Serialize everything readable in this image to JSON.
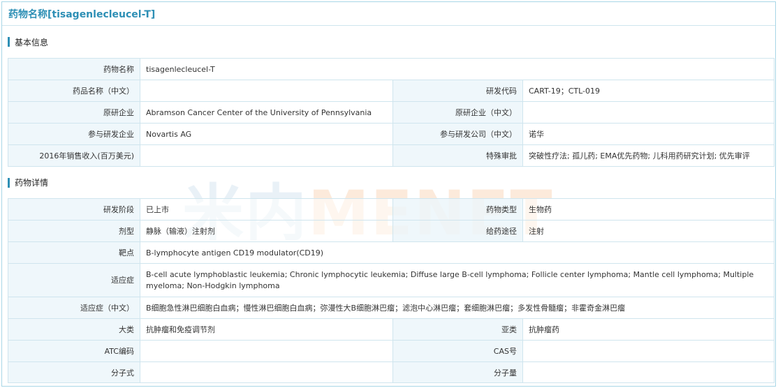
{
  "page_title": "药物名称[tisagenlecleucel-T]",
  "watermark": {
    "cn": "米内",
    "en": "MENET"
  },
  "basic_info": {
    "title": "基本信息",
    "drug_name_label": "药物名称",
    "drug_name_value": "tisagenlecleucel-T",
    "product_name_cn_label": "药品名称（中文）",
    "product_name_cn_value": "",
    "dev_code_label": "研发代码",
    "dev_code_value": "CART-19；CTL-019",
    "originator_label": "原研企业",
    "originator_value": "Abramson Cancer Center of the University of Pennsylvania",
    "originator_cn_label": "原研企业（中文）",
    "originator_cn_value": "",
    "partner_label": "参与研发企业",
    "partner_value": "Novartis AG",
    "partner_cn_label": "参与研发公司（中文）",
    "partner_cn_value": "诺华",
    "sales_label": "2016年销售收入(百万美元)",
    "sales_value": "",
    "special_review_label": "特殊审批",
    "special_review_value": "突破性疗法; 孤儿药; EMA优先药物; 儿科用药研究计划; 优先审评"
  },
  "drug_details": {
    "title": "药物详情",
    "stage_label": "研发阶段",
    "stage_value": "已上市",
    "drug_type_label": "药物类型",
    "drug_type_value": "生物药",
    "dosage_form_label": "剂型",
    "dosage_form_value": "静脉（输液）注射剂",
    "route_label": "给药途径",
    "route_value": "注射",
    "target_label": "靶点",
    "target_value": "B-lymphocyte antigen CD19 modulator(CD19)",
    "indication_label": "适应症",
    "indication_value": "B-cell acute lymphoblastic leukemia; Chronic lymphocytic leukemia; Diffuse large B-cell lymphoma; Follicle center lymphoma; Mantle cell lymphoma; Multiple myeloma; Non-Hodgkin lymphoma",
    "indication_cn_label": "适应症（中文）",
    "indication_cn_value": "B细胞急性淋巴细胞白血病；慢性淋巴细胞白血病；弥漫性大B细胞淋巴瘤；滤泡中心淋巴瘤；套细胞淋巴瘤；多发性骨髓瘤；非霍奇金淋巴瘤",
    "category_label": "大类",
    "category_value": "抗肿瘤和免疫调节剂",
    "subcategory_label": "亚类",
    "subcategory_value": "抗肿瘤药",
    "atc_label": "ATC编码",
    "atc_value": "",
    "cas_label": "CAS号",
    "cas_value": "",
    "formula_label": "分子式",
    "formula_value": "",
    "mol_weight_label": "分子量",
    "mol_weight_value": ""
  }
}
